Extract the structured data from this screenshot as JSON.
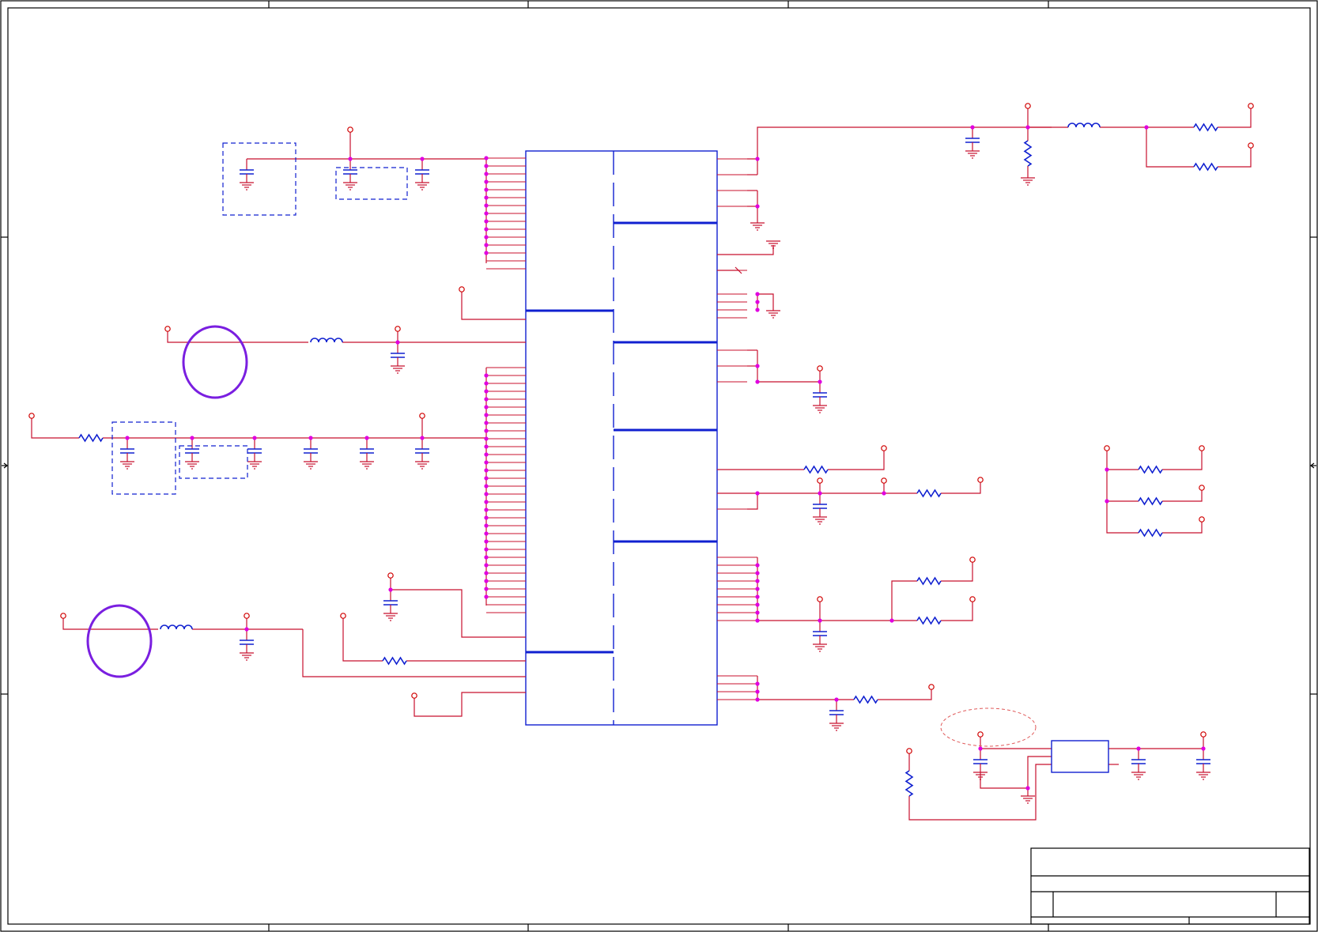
{
  "sheet": {
    "title": "",
    "colors": {
      "wire": "#c8102e",
      "component": "#1020d0",
      "junction": "#e000e0",
      "port": "#d00000",
      "highlight": "#7a1fe0",
      "frame": "#000000"
    }
  },
  "title_block": {
    "title": "",
    "sheet": "",
    "rev": ""
  }
}
